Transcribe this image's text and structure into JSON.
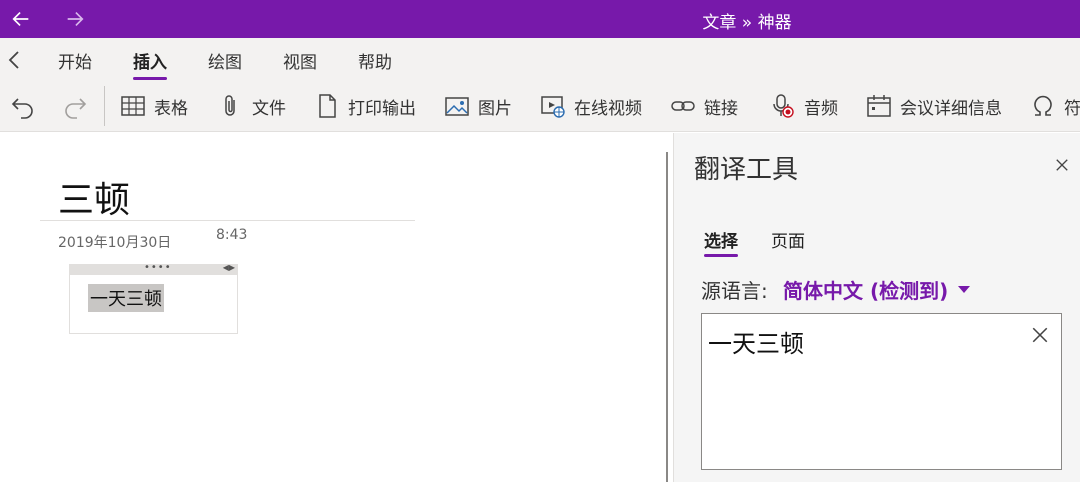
{
  "window": {
    "title": "文章 » 神器"
  },
  "ribbon": {
    "tabs": [
      {
        "label": "开始"
      },
      {
        "label": "插入",
        "active": true
      },
      {
        "label": "绘图"
      },
      {
        "label": "视图"
      },
      {
        "label": "帮助"
      }
    ]
  },
  "toolbar": {
    "undo_icon": "undo-icon",
    "redo_icon": "redo-icon",
    "items": [
      {
        "label": "表格",
        "icon": "table-icon"
      },
      {
        "label": "文件",
        "icon": "paperclip-icon"
      },
      {
        "label": "打印输出",
        "icon": "document-icon"
      },
      {
        "label": "图片",
        "icon": "picture-icon"
      },
      {
        "label": "在线视频",
        "icon": "online-video-icon"
      },
      {
        "label": "链接",
        "icon": "link-icon"
      },
      {
        "label": "音频",
        "icon": "audio-icon"
      },
      {
        "label": "会议详细信息",
        "icon": "calendar-icon"
      },
      {
        "label": "符",
        "icon": "omega-icon"
      }
    ]
  },
  "note": {
    "title": "三顿",
    "date": "2019年10月30日",
    "time": "8:43",
    "container_text": "一天三顿"
  },
  "translator": {
    "title": "翻译工具",
    "tabs": [
      {
        "label": "选择",
        "active": true
      },
      {
        "label": "页面"
      }
    ],
    "source_label": "源语言:",
    "source_value": "简体中文 (检测到)",
    "input_text": "一天三顿"
  },
  "colors": {
    "accent": "#7719aa",
    "ribbon_bg": "#f3f2f1",
    "pane_bg": "#f5f5f5"
  }
}
